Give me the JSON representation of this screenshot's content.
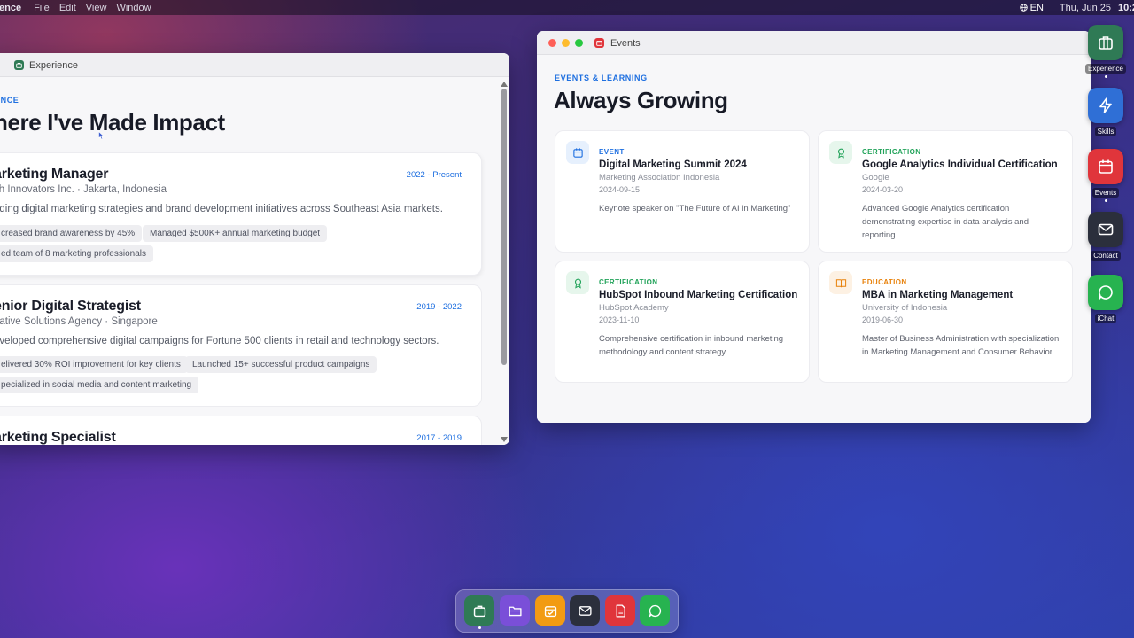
{
  "menubar": {
    "app_name": "ence",
    "menus": [
      "File",
      "Edit",
      "View",
      "Window"
    ],
    "language": "EN",
    "date": "Thu, Jun 25",
    "time": "10:2"
  },
  "experience_window": {
    "title": "Experience",
    "eyebrow": "ENCE",
    "heading": "here I've Made Impact",
    "jobs": [
      {
        "title": "arketing Manager",
        "company": "ch Innovators Inc. · Jakarta, Indonesia",
        "period": "2022 - Present",
        "description": "ading digital marketing strategies and brand development initiatives across Southeast Asia markets.",
        "achievements": [
          "creased brand awareness by 45%",
          "Managed $500K+ annual marketing budget",
          "ed team of 8 marketing professionals"
        ]
      },
      {
        "title": "enior Digital Strategist",
        "company": "eative Solutions Agency · Singapore",
        "period": "2019 - 2022",
        "description": "eveloped comprehensive digital campaigns for Fortune 500 clients in retail and technology sectors.",
        "achievements": [
          "elivered 30% ROI improvement for key clients",
          "Launched 15+ successful product campaigns",
          "pecialized in social media and content marketing"
        ]
      },
      {
        "title": "arketing Specialist",
        "period": "2017 - 2019"
      }
    ]
  },
  "events_window": {
    "title": "Events",
    "eyebrow": "EVENTS & LEARNING",
    "heading": "Always Growing",
    "items": [
      {
        "type": "EVENT",
        "title": "Digital Marketing Summit 2024",
        "org": "Marketing Association Indonesia",
        "date": "2024-09-15",
        "description": "Keynote speaker on \"The Future of AI in Marketing\"",
        "icon": "calendar-icon",
        "color": "#1e6fe0"
      },
      {
        "type": "CERTIFICATION",
        "title": "Google Analytics Individual Certification",
        "org": "Google",
        "date": "2024-03-20",
        "description": "Advanced Google Analytics certification demonstrating expertise in data analysis and reporting",
        "icon": "award-icon",
        "color": "#22a35a"
      },
      {
        "type": "CERTIFICATION",
        "title": "HubSpot Inbound Marketing Certification",
        "org": "HubSpot Academy",
        "date": "2023-11-10",
        "description": "Comprehensive certification in inbound marketing methodology and content strategy",
        "icon": "award-icon",
        "color": "#22a35a"
      },
      {
        "type": "EDUCATION",
        "title": "MBA in Marketing Management",
        "org": "University of Indonesia",
        "date": "2019-06-30",
        "description": "Master of Business Administration with specialization in Marketing Management and Consumer Behavior",
        "icon": "book-icon",
        "color": "#e8820c"
      }
    ]
  },
  "side_dock": {
    "apps": [
      {
        "label": "Experience",
        "icon": "briefcase-icon",
        "color": "#2f7a55"
      },
      {
        "label": "Skills",
        "icon": "lightning-icon",
        "color": "#2f6fd6"
      },
      {
        "label": "Events",
        "icon": "calendar-icon",
        "color": "#e0353b"
      },
      {
        "label": "Contact",
        "icon": "mail-icon",
        "color": "#2b2f3c"
      },
      {
        "label": "iChat",
        "icon": "chat-icon",
        "color": "#27b350"
      }
    ]
  },
  "bottom_dock": {
    "apps": [
      {
        "icon": "briefcase-icon",
        "color": "#2f7a55"
      },
      {
        "icon": "folder-icon",
        "color": "#7a4fd8"
      },
      {
        "icon": "calendar-check-icon",
        "color": "#f29b12"
      },
      {
        "icon": "mail-icon",
        "color": "#2b2f3c"
      },
      {
        "icon": "document-icon",
        "color": "#e0353b"
      },
      {
        "icon": "chat-icon",
        "color": "#27b350"
      }
    ]
  }
}
